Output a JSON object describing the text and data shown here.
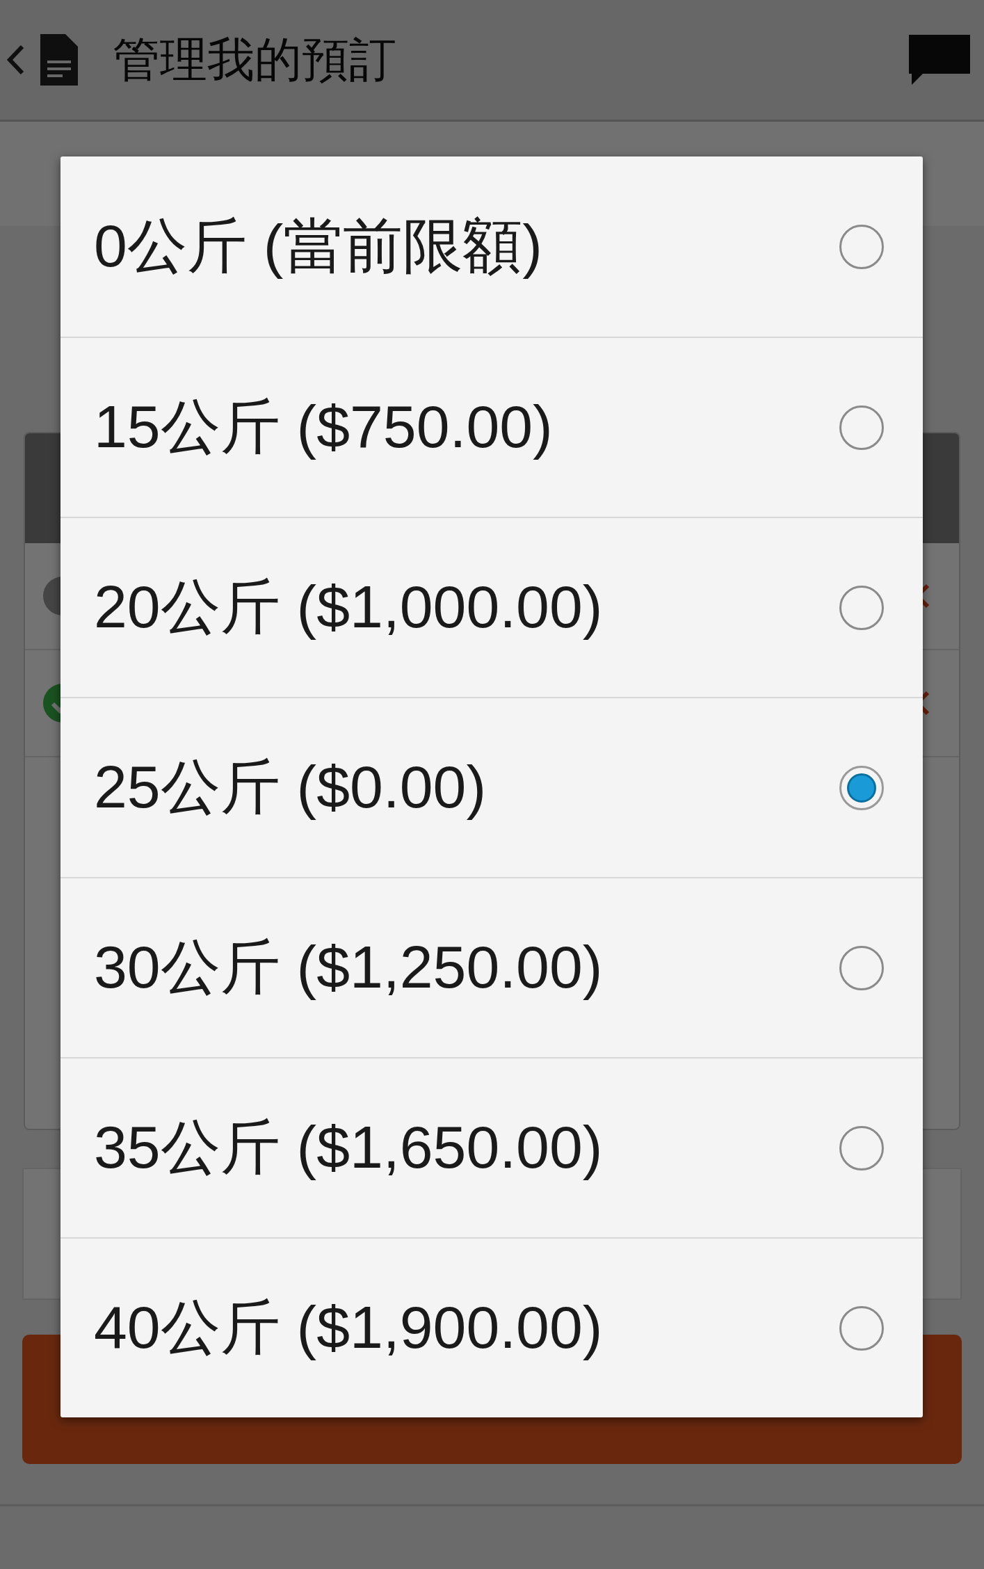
{
  "header": {
    "title": "管理我的預訂"
  },
  "options": [
    {
      "label": "0公斤 (當前限額)",
      "selected": false
    },
    {
      "label": "15公斤 ($750.00)",
      "selected": false
    },
    {
      "label": "20公斤 ($1,000.00)",
      "selected": false
    },
    {
      "label": "25公斤 ($0.00)",
      "selected": true
    },
    {
      "label": "30公斤 ($1,250.00)",
      "selected": false
    },
    {
      "label": "35公斤 ($1,650.00)",
      "selected": false
    },
    {
      "label": "40公斤 ($1,900.00)",
      "selected": false
    }
  ]
}
